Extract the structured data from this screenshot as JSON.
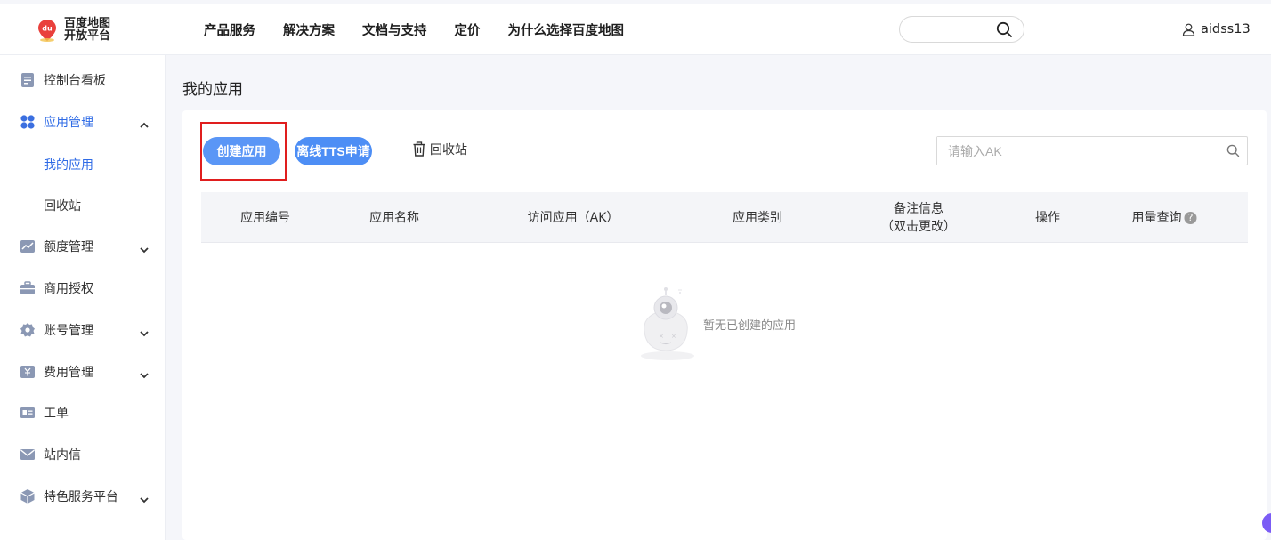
{
  "header": {
    "logo_line1": "百度地图",
    "logo_line2": "开放平台",
    "logo_badge": "du",
    "nav": [
      "产品服务",
      "解决方案",
      "文档与支持",
      "定价",
      "为什么选择百度地图"
    ],
    "search_placeholder": "",
    "username": "aidss13"
  },
  "sidebar": {
    "items": [
      {
        "label": "控制台看板",
        "icon": "dashboard-icon"
      },
      {
        "label": "应用管理",
        "icon": "apps-icon",
        "expanded": true
      },
      {
        "label": "额度管理",
        "icon": "chart-icon"
      },
      {
        "label": "商用授权",
        "icon": "briefcase-icon"
      },
      {
        "label": "账号管理",
        "icon": "gear-icon"
      },
      {
        "label": "费用管理",
        "icon": "yen-icon"
      },
      {
        "label": "工单",
        "icon": "ticket-icon"
      },
      {
        "label": "站内信",
        "icon": "mail-icon"
      },
      {
        "label": "特色服务平台",
        "icon": "cube-icon"
      }
    ],
    "sub_items": [
      "我的应用",
      "回收站"
    ]
  },
  "main": {
    "title": "我的应用",
    "create_button": "创建应用",
    "tts_button": "离线TTS申请",
    "recycle_link": "回收站",
    "ak_search_placeholder": "请输入AK",
    "columns": [
      "应用编号",
      "应用名称",
      "访问应用（AK）",
      "应用类别",
      "备注信息",
      "（双击更改）",
      "操作",
      "用量查询"
    ],
    "usage_help": "?",
    "empty_text": "暂无已创建的应用"
  },
  "colors": {
    "accent": "#4d8ef5",
    "active_text": "#2f6be6",
    "highlight_border": "#e01e1e"
  }
}
